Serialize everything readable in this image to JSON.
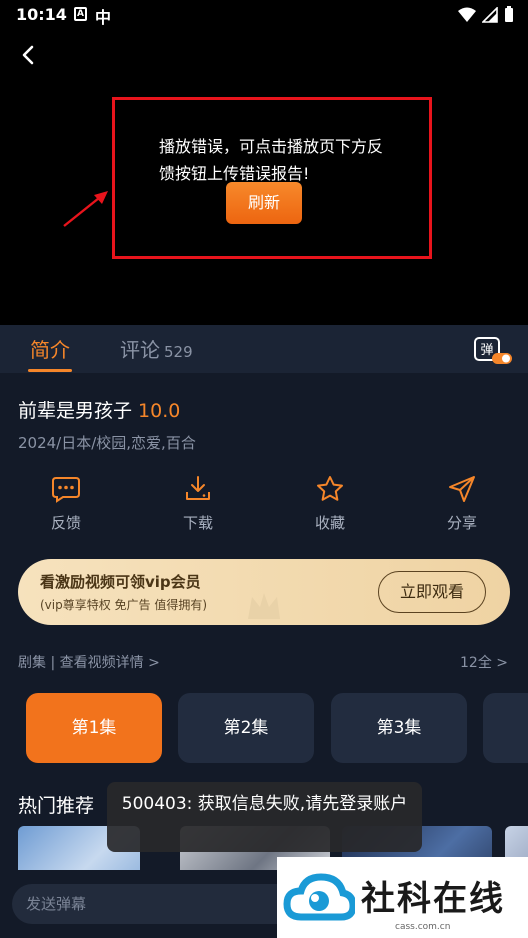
{
  "status_bar": {
    "time": "10:14",
    "a_icon": "A",
    "sim_label": "中"
  },
  "player": {
    "error_message": "播放错误，可点击播放页下方反馈按钮上传错误报告!",
    "refresh_label": "刷新"
  },
  "tabs": {
    "intro": "简介",
    "comments": "评论",
    "comments_count": "529",
    "danmaku_toggle_label": "弹"
  },
  "video": {
    "title": "前辈是男孩子",
    "score": "10.0",
    "meta": "2024/日本/校园,恋爱,百合"
  },
  "actions": [
    {
      "label": "反馈",
      "icon": "chat-bubble-icon"
    },
    {
      "label": "下载",
      "icon": "download-icon"
    },
    {
      "label": "收藏",
      "icon": "star-icon"
    },
    {
      "label": "分享",
      "icon": "send-icon"
    }
  ],
  "vip": {
    "title": "看激励视频可领vip会员",
    "subtitle": "(vip尊享特权 免广告 值得拥有)",
    "button": "立即观看"
  },
  "episodes": {
    "header": "剧集 | 查看视频详情 >",
    "total": "12全 >",
    "items": [
      "第1集",
      "第2集",
      "第3集"
    ]
  },
  "recommend": {
    "title": "热门推荐"
  },
  "toast": "500403: 获取信息失败,请先登录账户",
  "bottom": {
    "danmaku_placeholder": "发送弹幕"
  },
  "watermark": {
    "text": "社科在线",
    "sub": "cass.com.cn"
  },
  "colors": {
    "accent": "#f5862a",
    "error_border": "#e8141c",
    "background": "#131a28"
  }
}
